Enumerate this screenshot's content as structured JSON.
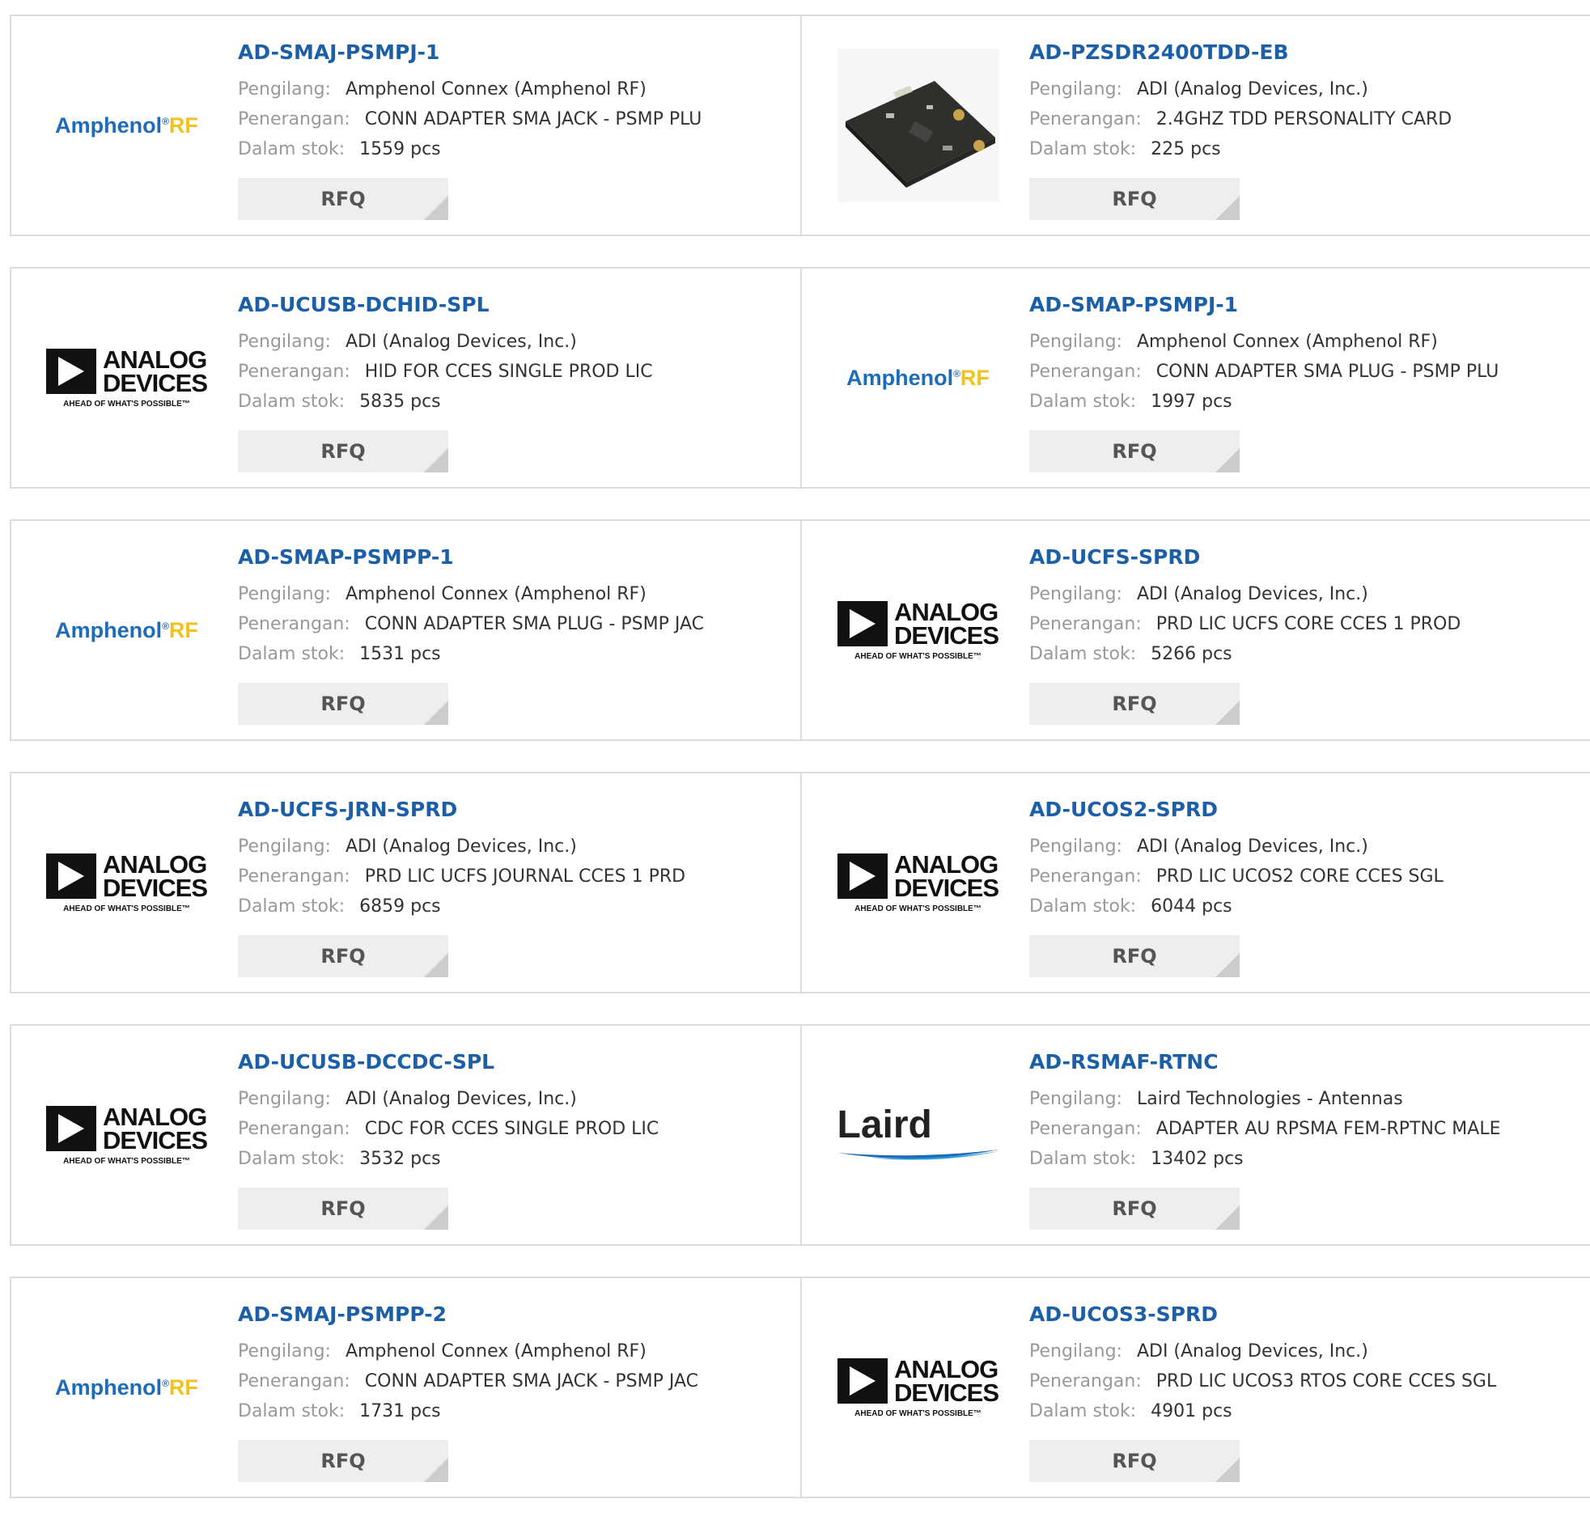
{
  "labels": {
    "manufacturer": "Pengilang:",
    "description": "Penerangan:",
    "stock": "Dalam stok:",
    "rfq": "RFQ"
  },
  "brand_logos": {
    "amphenol": {
      "main": "Amphenol",
      "reg": "®",
      "rf": "RF"
    },
    "adi": {
      "line1": "ANALOG",
      "line2": "DEVICES",
      "tagline": "AHEAD OF WHAT'S POSSIBLE™"
    },
    "laird": {
      "word": "Laird"
    }
  },
  "colors": {
    "link": "#1a5fa8",
    "label": "#999999",
    "value": "#333333",
    "button_bg": "#eeeeee",
    "border": "#dddddd",
    "amphenol_blue": "#1e6bb8",
    "amphenol_rf": "#f2c21a"
  },
  "products": [
    {
      "part": "AD-SMAJ-PSMPJ-1",
      "logo": "amphenol",
      "manufacturer": "Amphenol Connex (Amphenol RF)",
      "description": "CONN ADAPTER SMA JACK - PSMP PLU",
      "stock": "1559 pcs"
    },
    {
      "part": "AD-PZSDR2400TDD-EB",
      "logo": "pcb",
      "manufacturer": "ADI (Analog Devices, Inc.)",
      "description": "2.4GHZ TDD PERSONALITY CARD",
      "stock": "225 pcs"
    },
    {
      "part": "AD-UCUSB-DCHID-SPL",
      "logo": "adi",
      "manufacturer": "ADI (Analog Devices, Inc.)",
      "description": "HID FOR CCES SINGLE PROD LIC",
      "stock": "5835 pcs"
    },
    {
      "part": "AD-SMAP-PSMPJ-1",
      "logo": "amphenol",
      "manufacturer": "Amphenol Connex (Amphenol RF)",
      "description": "CONN ADAPTER SMA PLUG - PSMP PLU",
      "stock": "1997 pcs"
    },
    {
      "part": "AD-SMAP-PSMPP-1",
      "logo": "amphenol",
      "manufacturer": "Amphenol Connex (Amphenol RF)",
      "description": "CONN ADAPTER SMA PLUG - PSMP JAC",
      "stock": "1531 pcs"
    },
    {
      "part": "AD-UCFS-SPRD",
      "logo": "adi",
      "manufacturer": "ADI (Analog Devices, Inc.)",
      "description": "PRD LIC UCFS CORE CCES 1 PROD",
      "stock": "5266 pcs"
    },
    {
      "part": "AD-UCFS-JRN-SPRD",
      "logo": "adi",
      "manufacturer": "ADI (Analog Devices, Inc.)",
      "description": "PRD LIC UCFS JOURNAL CCES 1 PRD",
      "stock": "6859 pcs"
    },
    {
      "part": "AD-UCOS2-SPRD",
      "logo": "adi",
      "manufacturer": "ADI (Analog Devices, Inc.)",
      "description": "PRD LIC UCOS2 CORE CCES SGL",
      "stock": "6044 pcs"
    },
    {
      "part": "AD-UCUSB-DCCDC-SPL",
      "logo": "adi",
      "manufacturer": "ADI (Analog Devices, Inc.)",
      "description": "CDC FOR CCES SINGLE PROD LIC",
      "stock": "3532 pcs"
    },
    {
      "part": "AD-RSMAF-RTNC",
      "logo": "laird",
      "manufacturer": "Laird Technologies - Antennas",
      "description": "ADAPTER AU RPSMA FEM-RPTNC MALE",
      "stock": "13402 pcs"
    },
    {
      "part": "AD-SMAJ-PSMPP-2",
      "logo": "amphenol",
      "manufacturer": "Amphenol Connex (Amphenol RF)",
      "description": "CONN ADAPTER SMA JACK - PSMP JAC",
      "stock": "1731 pcs"
    },
    {
      "part": "AD-UCOS3-SPRD",
      "logo": "adi",
      "manufacturer": "ADI (Analog Devices, Inc.)",
      "description": "PRD LIC UCOS3 RTOS CORE CCES SGL",
      "stock": "4901 pcs"
    }
  ]
}
